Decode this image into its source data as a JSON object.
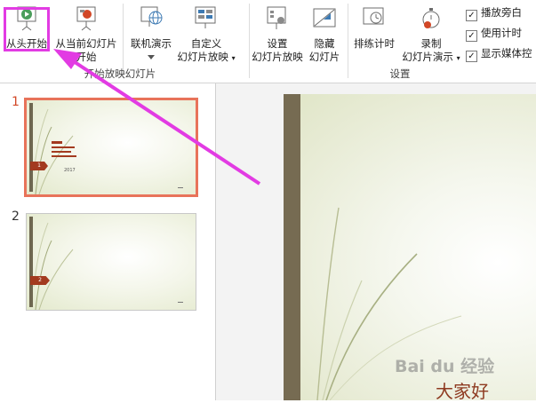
{
  "ribbon": {
    "from_beginning": "从头开始",
    "from_current_line1": "从当前幻灯片",
    "from_current_line2": "开始",
    "online_present": "联机演示",
    "custom_line1": "自定义",
    "custom_line2": "幻灯片放映",
    "setup_line1": "设置",
    "setup_line2": "幻灯片放映",
    "hide_line1": "隐藏",
    "hide_line2": "幻灯片",
    "rehearse": "排练计时",
    "record_line1": "录制",
    "record_line2": "幻灯片演示",
    "group_start": "开始放映幻灯片",
    "group_setup": "设置",
    "chk_narration": "播放旁白",
    "chk_timings": "使用计时",
    "chk_media": "显示媒体控"
  },
  "slides": {
    "slide1_num": "1",
    "slide2_num": "2",
    "slide1_badge": "1",
    "slide2_badge": "2",
    "slide1_year": "2017"
  },
  "main_slide": {
    "title": "大家好"
  },
  "watermark": "Bai du 经验",
  "colors": {
    "highlight": "#e23be3",
    "arrow": "#e23be3",
    "selected_border": "#e8735a",
    "slide_bar": "#766b52",
    "badge": "#a33a1f"
  }
}
